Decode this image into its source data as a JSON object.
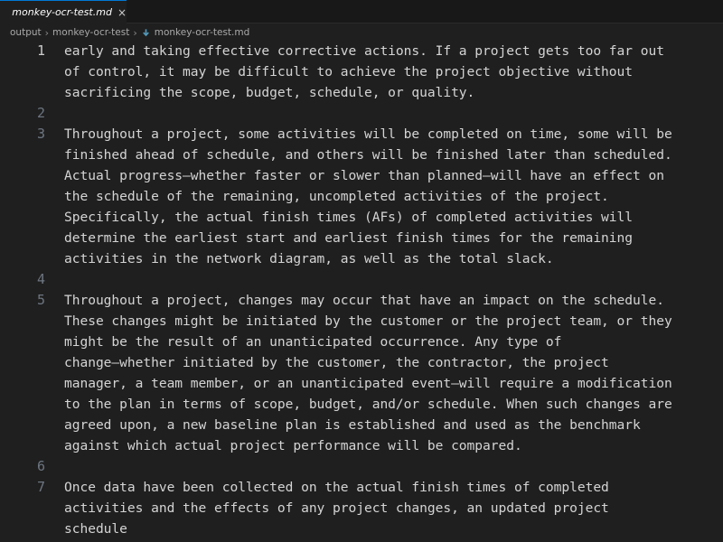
{
  "tab": {
    "title": "monkey-ocr-test.md",
    "icon": "markdown-download-icon",
    "close_glyph": "×",
    "accent": "#0078d4"
  },
  "breadcrumb": {
    "items": [
      "output",
      "monkey-ocr-test",
      "monkey-ocr-test.md"
    ]
  },
  "editor": {
    "lines": [
      {
        "num": "1",
        "text": "early and taking effective corrective actions. If a project gets too far out"
      },
      {
        "num": "",
        "text": "of control, it may be difficult to achieve the project objective without"
      },
      {
        "num": "",
        "text": "sacrificing the scope, budget, schedule, or quality."
      },
      {
        "num": "2",
        "text": ""
      },
      {
        "num": "3",
        "text": "Throughout a project, some activities will be completed on time, some will be"
      },
      {
        "num": "",
        "text": "finished ahead of schedule, and others will be finished later than scheduled."
      },
      {
        "num": "",
        "text": "Actual progress—whether faster or slower than planned—will have an effect on"
      },
      {
        "num": "",
        "text": "the schedule of the remaining, uncompleted activities of the project."
      },
      {
        "num": "",
        "text": "Specifically, the actual finish times (AFs) of completed activities will"
      },
      {
        "num": "",
        "text": "determine the earliest start and earliest finish times for the remaining"
      },
      {
        "num": "",
        "text": "activities in the network diagram, as well as the total slack."
      },
      {
        "num": "4",
        "text": ""
      },
      {
        "num": "5",
        "text": "Throughout a project, changes may occur that have an impact on the schedule."
      },
      {
        "num": "",
        "text": "These changes might be initiated by the customer or the project team, or they"
      },
      {
        "num": "",
        "text": "might be the result of an unanticipated occurrence. Any type of"
      },
      {
        "num": "",
        "text": "change—whether initiated by the customer, the contractor, the project"
      },
      {
        "num": "",
        "text": "manager, a team member, or an unanticipated event—will require a modification"
      },
      {
        "num": "",
        "text": "to the plan in terms of scope, budget, and/or schedule. When such changes are"
      },
      {
        "num": "",
        "text": "agreed upon, a new baseline plan is established and used as the benchmark"
      },
      {
        "num": "",
        "text": "against which actual project performance will be compared."
      },
      {
        "num": "6",
        "text": ""
      },
      {
        "num": "7",
        "text": "Once data have been collected on the actual finish times of completed"
      },
      {
        "num": "",
        "text": "activities and the effects of any project changes, an updated project"
      },
      {
        "num": "",
        "text": "schedule"
      }
    ]
  }
}
